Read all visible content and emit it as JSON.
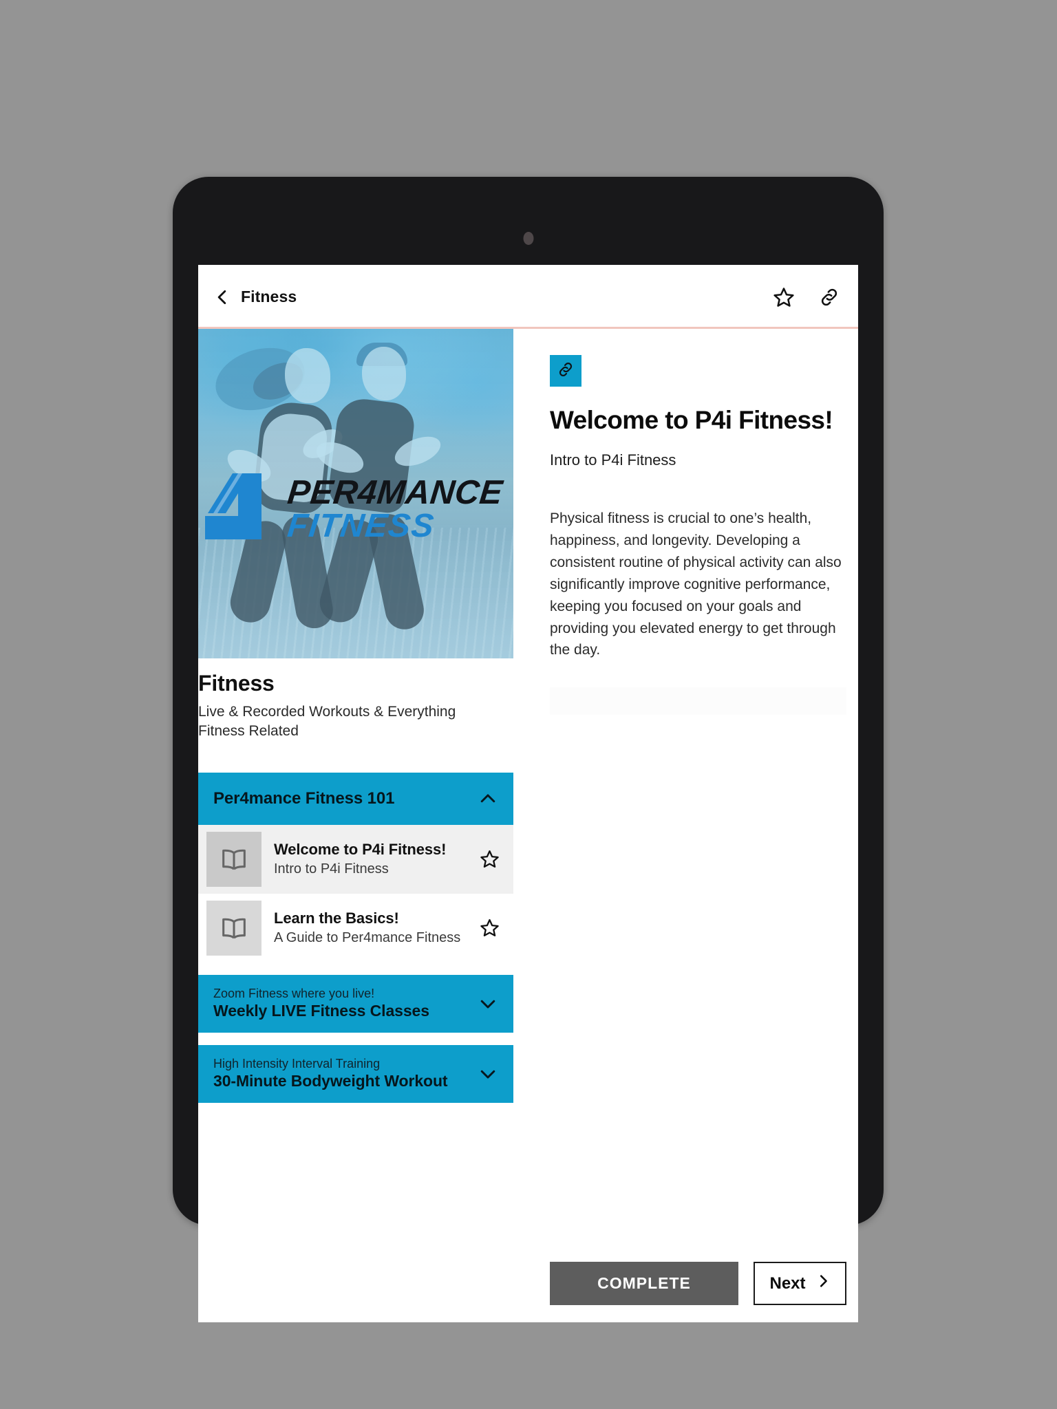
{
  "appbar": {
    "back_icon": "chevron-left-icon",
    "title": "Fitness",
    "favorite_icon": "star-outline-icon",
    "share_icon": "link-icon"
  },
  "hero": {
    "logo_word_1": "PER4MANCE",
    "logo_word_2": "FITNESS",
    "logo_mark": "number-4-logo-mark",
    "alt": "Two runners on a track with cyan duotone overlay"
  },
  "course": {
    "title": "Fitness",
    "subtitle": "Live & Recorded Workouts & Everything Fitness Related"
  },
  "sections": [
    {
      "eyebrow": "",
      "title": "Per4mance Fitness 101",
      "expanded": true,
      "chevron": "chevron-up-icon",
      "lessons": [
        {
          "title": "Welcome to P4i Fitness!",
          "subtitle": "Intro to P4i Fitness",
          "icon": "book-icon",
          "star_icon": "star-outline-icon",
          "active": true
        },
        {
          "title": "Learn the Basics!",
          "subtitle": "A Guide to Per4mance Fitness",
          "icon": "book-icon",
          "star_icon": "star-outline-icon",
          "active": false
        }
      ]
    },
    {
      "eyebrow": "Zoom Fitness where you live!",
      "title": "Weekly LIVE Fitness Classes",
      "expanded": false,
      "chevron": "chevron-down-icon",
      "lessons": []
    },
    {
      "eyebrow": "High Intensity Interval Training",
      "title": "30-Minute Bodyweight Workout",
      "expanded": false,
      "chevron": "chevron-down-icon",
      "lessons": []
    }
  ],
  "lesson_detail": {
    "badge_icon": "link-icon",
    "heading": "Welcome to P4i Fitness!",
    "subheading": "Intro to P4i Fitness",
    "body": "Physical fitness is crucial to one’s health, happiness, and longevity. Developing a consistent routine of physical activity can also significantly improve cognitive performance, keeping you focused on your goals and providing you elevated energy to get through the day."
  },
  "actions": {
    "complete_label": "COMPLETE",
    "next_label": "Next",
    "next_icon": "chevron-right-icon"
  },
  "colors": {
    "accent_cyan": "#0d9ecb",
    "logo_blue": "#1f86d0",
    "complete_grey": "#5d5d5d",
    "divider_pink": "#f1c6be",
    "device_body": "#18181a",
    "page_background": "#949494"
  }
}
